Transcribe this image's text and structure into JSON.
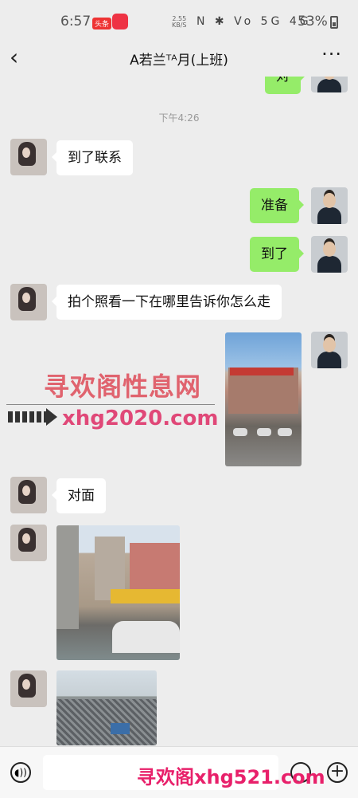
{
  "status_bar": {
    "time": "6:57",
    "toutiao_label": "头条",
    "net_speed": "2.55",
    "net_speed_unit": "KB/S",
    "signal_icons": "N ✱ Vo 5G 4G",
    "battery": "53%"
  },
  "header": {
    "back_icon": "‹",
    "title": "A若兰ᵀᴬ月(上班)",
    "more_icon": "···"
  },
  "chat": {
    "top_partial_message": "对",
    "timestamp": "下午4:26",
    "messages": [
      {
        "side": "left",
        "text": "到了联系"
      },
      {
        "side": "right",
        "text": "准备"
      },
      {
        "side": "right",
        "text": "到了"
      },
      {
        "side": "left",
        "text": "拍个照看一下在哪里告诉你怎么走"
      },
      {
        "side": "right",
        "type": "image"
      },
      {
        "side": "left",
        "text": "对面"
      },
      {
        "side": "left",
        "type": "image"
      },
      {
        "side": "left",
        "type": "image"
      }
    ]
  },
  "watermarks": {
    "site_name": "寻欢阁性息网",
    "site_url": "xhg2020.com",
    "bottom": "寻欢阁xhg521.com"
  },
  "input_bar": {
    "voice_icon": "voice-icon",
    "emoji_icon": "emoji-icon",
    "plus_icon": "plus-icon",
    "plus_symbol": "+"
  }
}
